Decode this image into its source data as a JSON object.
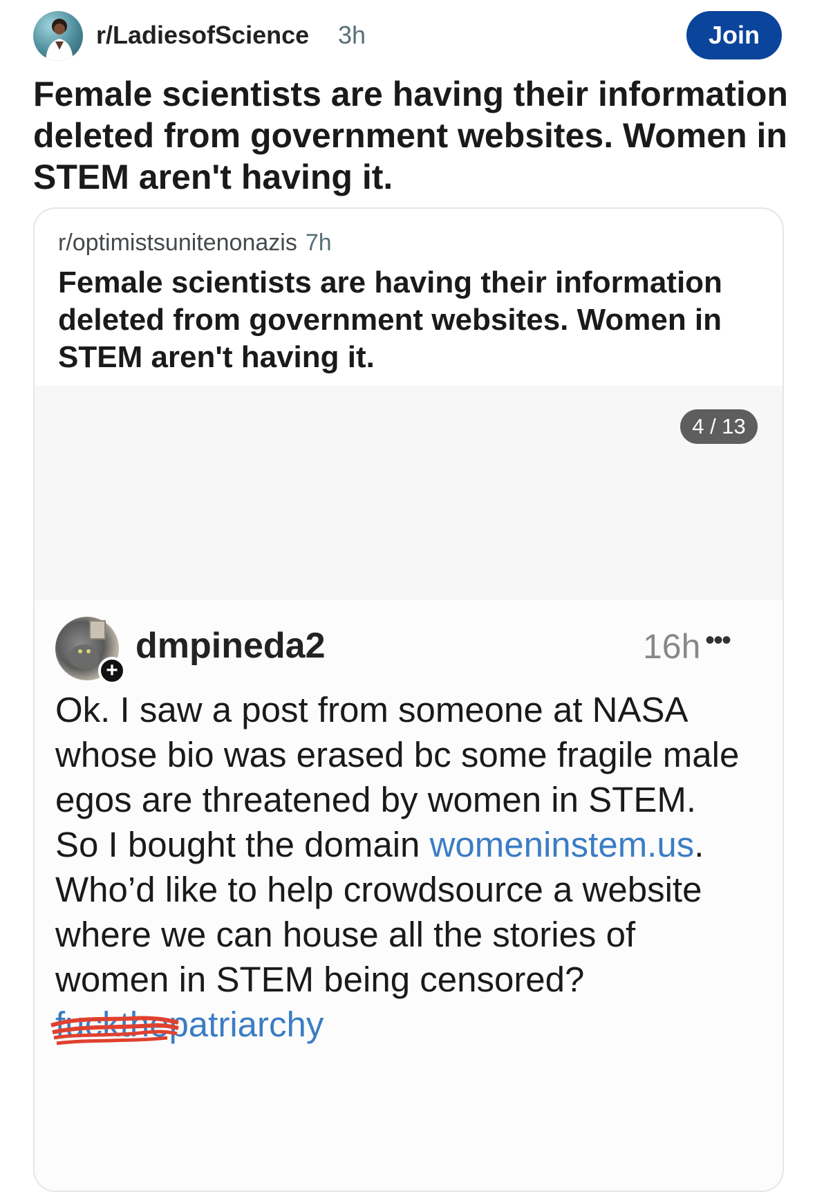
{
  "header": {
    "subreddit": "r/LadiesofScience",
    "time": "3h",
    "join_label": "Join"
  },
  "post": {
    "title": "Female scientists are having their information deleted from government websites. Women in STEM aren't having it."
  },
  "crosspost": {
    "subreddit": "r/optimistsunitenonazis",
    "time": "7h",
    "title": "Female scientists are having their information deleted from government websites. Women in STEM aren't having it.",
    "gallery_counter": "4 / 13",
    "screenshot": {
      "username": "dmpineda2",
      "time": "16h",
      "more": "•••",
      "plus": "+",
      "body_part1": "Ok. I saw a post from someone at NASA whose bio was erased bc some fragile male egos are threatened by women in STEM. So I bought the domain ",
      "link": "womeninstem.us",
      "body_part2": ". Who’d like to help crowdsource a website where we can house all the stories of women in STEM being censored? ",
      "hashtag_struck": "fuckthe",
      "hashtag_rest": "patriarchy"
    }
  },
  "colors": {
    "join_button": "#0a449b",
    "link": "#3b7dc4",
    "scribble": "#e0412f"
  }
}
